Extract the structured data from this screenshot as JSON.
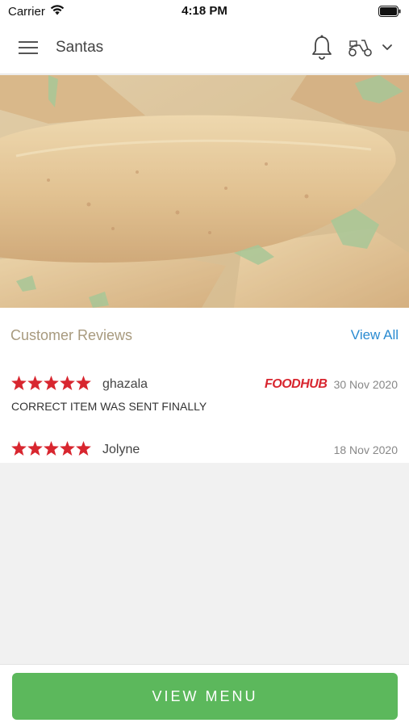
{
  "status_bar": {
    "carrier": "Carrier",
    "time": "4:18 PM"
  },
  "header": {
    "shop_name": "Santas"
  },
  "reviews": {
    "title": "Customer Reviews",
    "view_all": "View All",
    "items": [
      {
        "stars": 5,
        "name": "ghazala",
        "source": "FOODHUB",
        "date": "30 Nov 2020",
        "comment": "CORRECT ITEM WAS SENT FINALLY"
      },
      {
        "stars": 5,
        "name": "Jolyne",
        "source": "",
        "date": "18 Nov 2020",
        "comment": ""
      }
    ]
  },
  "footer": {
    "button_label": "VIEW MENU"
  },
  "colors": {
    "accent_green": "#5cb85c",
    "star_red": "#d8262f",
    "link_blue": "#2a8bd1",
    "heading_tan": "#a89a7e"
  },
  "icons": [
    "wifi-icon",
    "battery-icon",
    "hamburger-menu-icon",
    "bell-icon",
    "scooter-icon",
    "chevron-down-icon",
    "star-icon"
  ]
}
